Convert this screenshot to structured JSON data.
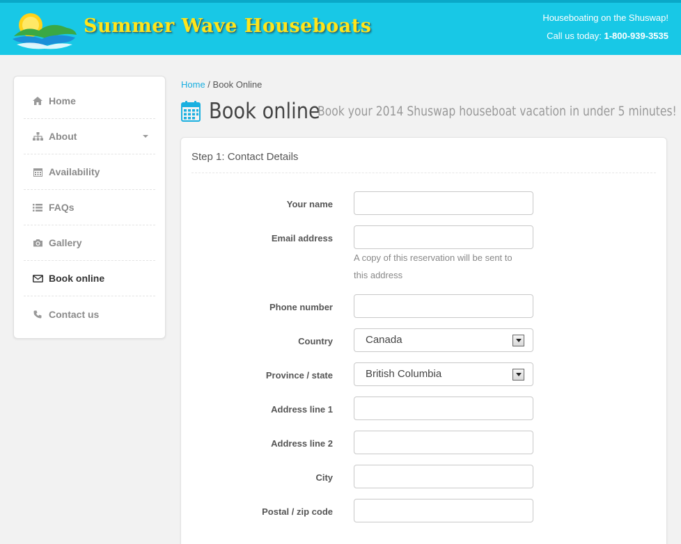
{
  "header": {
    "site_name": "Summer Wave Houseboats",
    "tagline": "Houseboating on the Shuswap!",
    "call_prefix": "Call us today: ",
    "phone": "1-800-939-3535",
    "colors": {
      "header_bg": "#18c8e6",
      "logo_text": "#ffe51a"
    }
  },
  "sidebar": {
    "items": [
      {
        "label": "Home",
        "icon": "home-icon"
      },
      {
        "label": "About",
        "icon": "sitemap-icon"
      },
      {
        "label": "Availability",
        "icon": "calendar-icon"
      },
      {
        "label": "FAQs",
        "icon": "list-icon"
      },
      {
        "label": "Gallery",
        "icon": "camera-icon"
      },
      {
        "label": "Book online",
        "icon": "envelope-icon",
        "active": true
      },
      {
        "label": "Contact us",
        "icon": "phone-icon"
      }
    ]
  },
  "breadcrumb": {
    "home": "Home",
    "separator": " / ",
    "current": "Book Online"
  },
  "page": {
    "title": "Book online",
    "subtitle": "Book your 2014 Shuswap houseboat vacation in under 5 minutes!"
  },
  "form": {
    "step_title": "Step 1: Contact Details",
    "fields": {
      "name": {
        "label": "Your name",
        "value": ""
      },
      "email": {
        "label": "Email address",
        "value": "",
        "help": "A copy of this reservation will be sent to this address"
      },
      "phone": {
        "label": "Phone number",
        "value": ""
      },
      "country": {
        "label": "Country",
        "selected": "Canada"
      },
      "province": {
        "label": "Province / state",
        "selected": "British Columbia"
      },
      "address1": {
        "label": "Address line 1",
        "value": ""
      },
      "address2": {
        "label": "Address line 2",
        "value": ""
      },
      "city": {
        "label": "City",
        "value": ""
      },
      "postal": {
        "label": "Postal / zip code",
        "value": ""
      }
    }
  }
}
